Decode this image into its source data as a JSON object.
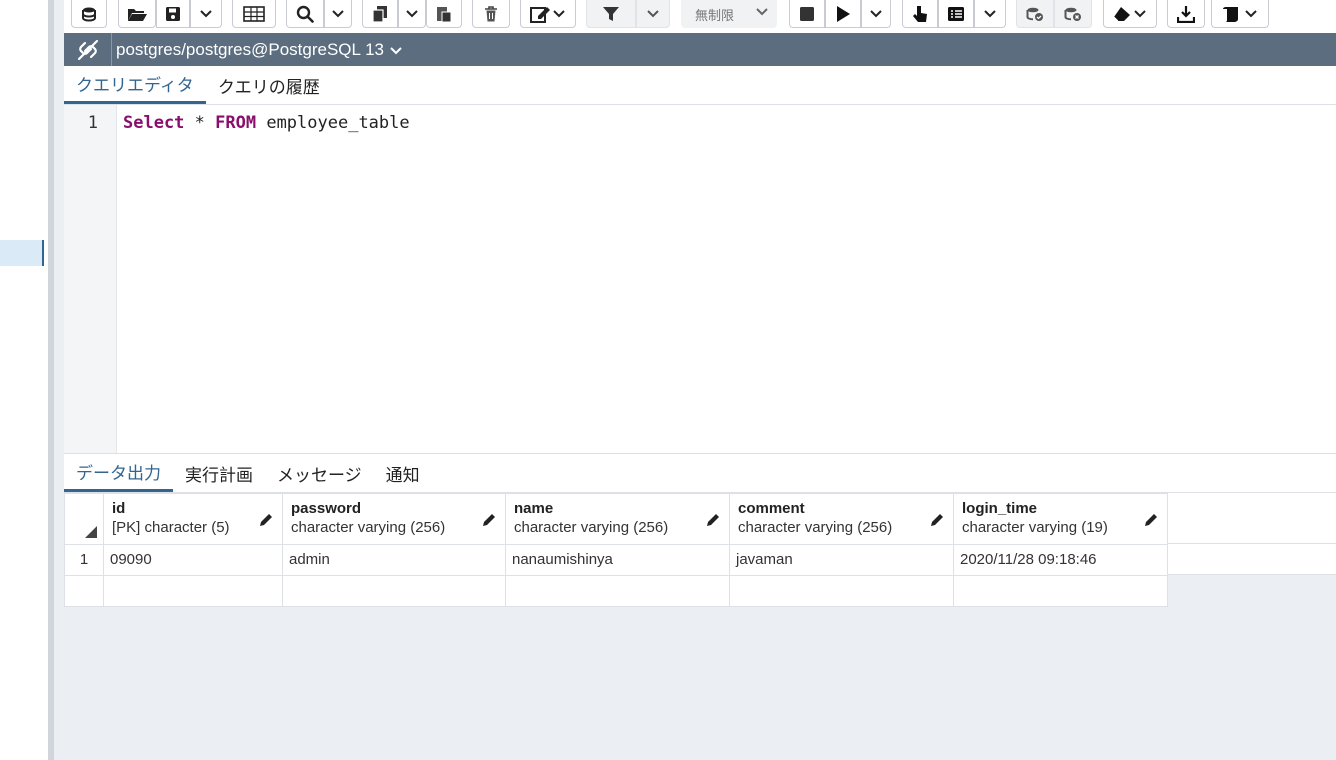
{
  "connection": {
    "label": "postgres/postgres@PostgreSQL 13"
  },
  "toolbar": {
    "row_limit": "無制限",
    "icons": [
      "database-icon",
      "folder-open-icon",
      "save-icon",
      "save-dropdown-icon",
      "edit-grid-icon",
      "search-icon",
      "search-dropdown-icon",
      "copy-icon",
      "copy-dropdown-icon",
      "paste-icon",
      "delete-icon",
      "edit-dropdown-icon",
      "filter-icon",
      "filter-dropdown-icon",
      "stop-icon",
      "execute-icon",
      "execute-dropdown-icon",
      "explain-icon",
      "explain-analyze-icon",
      "explain-dropdown-icon",
      "commit-icon",
      "rollback-icon",
      "clear-icon",
      "download-icon",
      "macros-icon"
    ]
  },
  "query_tabs": [
    {
      "label": "クエリエディタ",
      "active": true
    },
    {
      "label": "クエリの履歴",
      "active": false
    }
  ],
  "editor": {
    "line_number": "1",
    "tokens": {
      "kw1": "Select",
      "op": " * ",
      "kw2": "FROM",
      "rest": " employee_table"
    }
  },
  "result_tabs": [
    {
      "label": "データ出力",
      "active": true
    },
    {
      "label": "実行計画",
      "active": false
    },
    {
      "label": "メッセージ",
      "active": false
    },
    {
      "label": "通知",
      "active": false
    }
  ],
  "grid": {
    "columns": [
      {
        "name": "id",
        "type": "[PK] character (5)"
      },
      {
        "name": "password",
        "type": "character varying (256)"
      },
      {
        "name": "name",
        "type": "character varying (256)"
      },
      {
        "name": "comment",
        "type": "character varying (256)"
      },
      {
        "name": "login_time",
        "type": "character varying (19)"
      }
    ],
    "rows": [
      {
        "num": "1",
        "cells": [
          "09090",
          "admin",
          "nanaumishinya",
          "javaman",
          "2020/11/28 09:18:46"
        ]
      }
    ]
  },
  "colors": {
    "accent": "#326690",
    "connbar": "#5b6d7f",
    "keyword": "#8a0e6c"
  }
}
